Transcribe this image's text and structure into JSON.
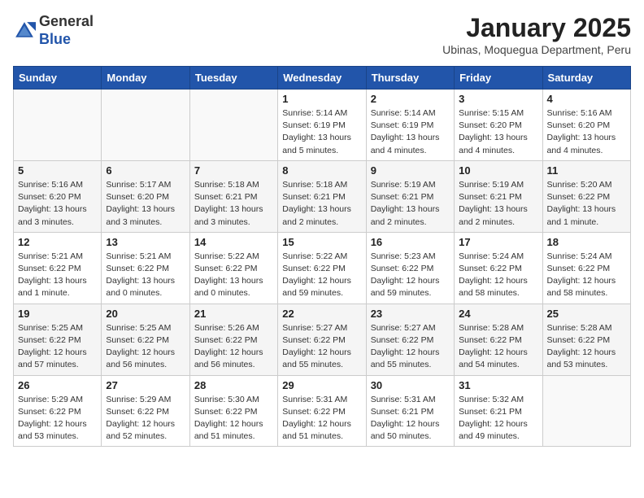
{
  "header": {
    "logo_general": "General",
    "logo_blue": "Blue",
    "month": "January 2025",
    "location": "Ubinas, Moquegua Department, Peru"
  },
  "weekdays": [
    "Sunday",
    "Monday",
    "Tuesday",
    "Wednesday",
    "Thursday",
    "Friday",
    "Saturday"
  ],
  "weeks": [
    [
      {
        "day": "",
        "info": ""
      },
      {
        "day": "",
        "info": ""
      },
      {
        "day": "",
        "info": ""
      },
      {
        "day": "1",
        "info": "Sunrise: 5:14 AM\nSunset: 6:19 PM\nDaylight: 13 hours and 5 minutes."
      },
      {
        "day": "2",
        "info": "Sunrise: 5:14 AM\nSunset: 6:19 PM\nDaylight: 13 hours and 4 minutes."
      },
      {
        "day": "3",
        "info": "Sunrise: 5:15 AM\nSunset: 6:20 PM\nDaylight: 13 hours and 4 minutes."
      },
      {
        "day": "4",
        "info": "Sunrise: 5:16 AM\nSunset: 6:20 PM\nDaylight: 13 hours and 4 minutes."
      }
    ],
    [
      {
        "day": "5",
        "info": "Sunrise: 5:16 AM\nSunset: 6:20 PM\nDaylight: 13 hours and 3 minutes."
      },
      {
        "day": "6",
        "info": "Sunrise: 5:17 AM\nSunset: 6:20 PM\nDaylight: 13 hours and 3 minutes."
      },
      {
        "day": "7",
        "info": "Sunrise: 5:18 AM\nSunset: 6:21 PM\nDaylight: 13 hours and 3 minutes."
      },
      {
        "day": "8",
        "info": "Sunrise: 5:18 AM\nSunset: 6:21 PM\nDaylight: 13 hours and 2 minutes."
      },
      {
        "day": "9",
        "info": "Sunrise: 5:19 AM\nSunset: 6:21 PM\nDaylight: 13 hours and 2 minutes."
      },
      {
        "day": "10",
        "info": "Sunrise: 5:19 AM\nSunset: 6:21 PM\nDaylight: 13 hours and 2 minutes."
      },
      {
        "day": "11",
        "info": "Sunrise: 5:20 AM\nSunset: 6:22 PM\nDaylight: 13 hours and 1 minute."
      }
    ],
    [
      {
        "day": "12",
        "info": "Sunrise: 5:21 AM\nSunset: 6:22 PM\nDaylight: 13 hours and 1 minute."
      },
      {
        "day": "13",
        "info": "Sunrise: 5:21 AM\nSunset: 6:22 PM\nDaylight: 13 hours and 0 minutes."
      },
      {
        "day": "14",
        "info": "Sunrise: 5:22 AM\nSunset: 6:22 PM\nDaylight: 13 hours and 0 minutes."
      },
      {
        "day": "15",
        "info": "Sunrise: 5:22 AM\nSunset: 6:22 PM\nDaylight: 12 hours and 59 minutes."
      },
      {
        "day": "16",
        "info": "Sunrise: 5:23 AM\nSunset: 6:22 PM\nDaylight: 12 hours and 59 minutes."
      },
      {
        "day": "17",
        "info": "Sunrise: 5:24 AM\nSunset: 6:22 PM\nDaylight: 12 hours and 58 minutes."
      },
      {
        "day": "18",
        "info": "Sunrise: 5:24 AM\nSunset: 6:22 PM\nDaylight: 12 hours and 58 minutes."
      }
    ],
    [
      {
        "day": "19",
        "info": "Sunrise: 5:25 AM\nSunset: 6:22 PM\nDaylight: 12 hours and 57 minutes."
      },
      {
        "day": "20",
        "info": "Sunrise: 5:25 AM\nSunset: 6:22 PM\nDaylight: 12 hours and 56 minutes."
      },
      {
        "day": "21",
        "info": "Sunrise: 5:26 AM\nSunset: 6:22 PM\nDaylight: 12 hours and 56 minutes."
      },
      {
        "day": "22",
        "info": "Sunrise: 5:27 AM\nSunset: 6:22 PM\nDaylight: 12 hours and 55 minutes."
      },
      {
        "day": "23",
        "info": "Sunrise: 5:27 AM\nSunset: 6:22 PM\nDaylight: 12 hours and 55 minutes."
      },
      {
        "day": "24",
        "info": "Sunrise: 5:28 AM\nSunset: 6:22 PM\nDaylight: 12 hours and 54 minutes."
      },
      {
        "day": "25",
        "info": "Sunrise: 5:28 AM\nSunset: 6:22 PM\nDaylight: 12 hours and 53 minutes."
      }
    ],
    [
      {
        "day": "26",
        "info": "Sunrise: 5:29 AM\nSunset: 6:22 PM\nDaylight: 12 hours and 53 minutes."
      },
      {
        "day": "27",
        "info": "Sunrise: 5:29 AM\nSunset: 6:22 PM\nDaylight: 12 hours and 52 minutes."
      },
      {
        "day": "28",
        "info": "Sunrise: 5:30 AM\nSunset: 6:22 PM\nDaylight: 12 hours and 51 minutes."
      },
      {
        "day": "29",
        "info": "Sunrise: 5:31 AM\nSunset: 6:22 PM\nDaylight: 12 hours and 51 minutes."
      },
      {
        "day": "30",
        "info": "Sunrise: 5:31 AM\nSunset: 6:21 PM\nDaylight: 12 hours and 50 minutes."
      },
      {
        "day": "31",
        "info": "Sunrise: 5:32 AM\nSunset: 6:21 PM\nDaylight: 12 hours and 49 minutes."
      },
      {
        "day": "",
        "info": ""
      }
    ]
  ]
}
